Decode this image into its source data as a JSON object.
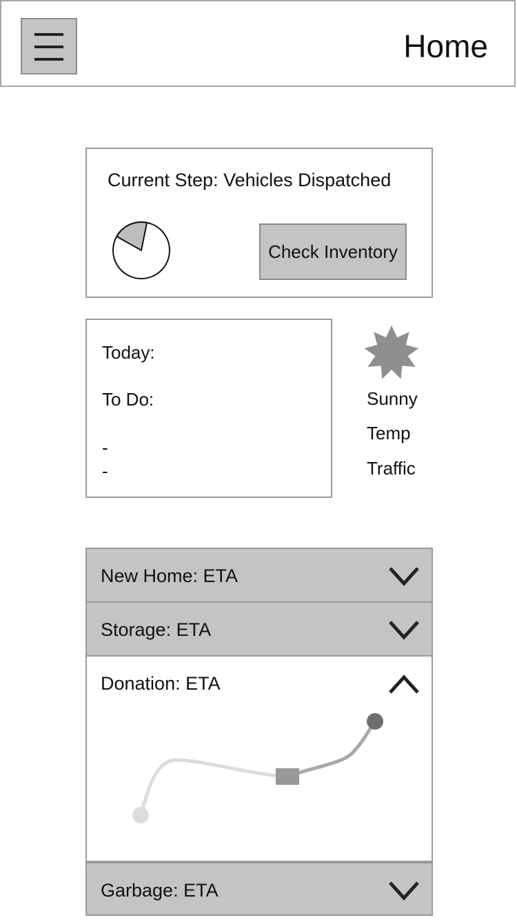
{
  "header": {
    "title": "Home",
    "menu_icon": "hamburger-menu-icon"
  },
  "status": {
    "current_step": "Current Step: Vehicles Dispatched",
    "progress_fraction": 0.2,
    "check_inventory_label": "Check Inventory"
  },
  "today": {
    "today_label": "Today:",
    "todo_label": "To Do:",
    "items": [
      "-",
      "-"
    ]
  },
  "weather": {
    "icon": "sun-icon",
    "condition": "Sunny",
    "temp_label": "Temp",
    "traffic_label": "Traffic"
  },
  "deliveries": [
    {
      "label": "New Home: ETA",
      "expanded": false
    },
    {
      "label": "Storage: ETA",
      "expanded": false
    },
    {
      "label": "Donation: ETA",
      "expanded": true
    },
    {
      "label": "Garbage: ETA",
      "expanded": false
    }
  ]
}
